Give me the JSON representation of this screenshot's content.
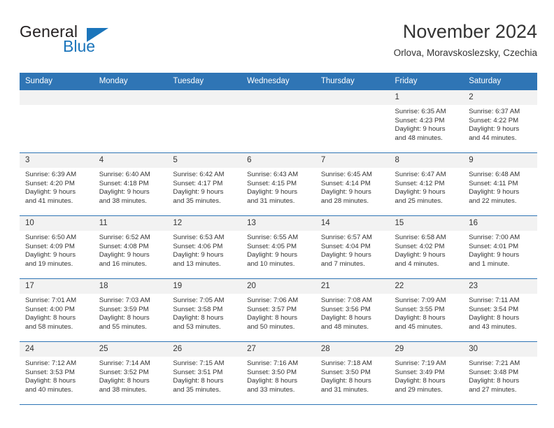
{
  "brand": {
    "name_part1": "General",
    "name_part2": "Blue",
    "accent_color": "#1b75bb"
  },
  "header": {
    "title": "November 2024",
    "subtitle": "Orlova, Moravskoslezsky, Czechia"
  },
  "theme": {
    "header_bg": "#2f75b5",
    "daynum_bg": "#f2f2f2",
    "text_color": "#333333"
  },
  "calendar": {
    "weekday_headers": [
      "Sunday",
      "Monday",
      "Tuesday",
      "Wednesday",
      "Thursday",
      "Friday",
      "Saturday"
    ],
    "weeks": [
      [
        {
          "day": "",
          "lines": []
        },
        {
          "day": "",
          "lines": []
        },
        {
          "day": "",
          "lines": []
        },
        {
          "day": "",
          "lines": []
        },
        {
          "day": "",
          "lines": []
        },
        {
          "day": "1",
          "lines": [
            "Sunrise: 6:35 AM",
            "Sunset: 4:23 PM",
            "Daylight: 9 hours",
            "and 48 minutes."
          ]
        },
        {
          "day": "2",
          "lines": [
            "Sunrise: 6:37 AM",
            "Sunset: 4:22 PM",
            "Daylight: 9 hours",
            "and 44 minutes."
          ]
        }
      ],
      [
        {
          "day": "3",
          "lines": [
            "Sunrise: 6:39 AM",
            "Sunset: 4:20 PM",
            "Daylight: 9 hours",
            "and 41 minutes."
          ]
        },
        {
          "day": "4",
          "lines": [
            "Sunrise: 6:40 AM",
            "Sunset: 4:18 PM",
            "Daylight: 9 hours",
            "and 38 minutes."
          ]
        },
        {
          "day": "5",
          "lines": [
            "Sunrise: 6:42 AM",
            "Sunset: 4:17 PM",
            "Daylight: 9 hours",
            "and 35 minutes."
          ]
        },
        {
          "day": "6",
          "lines": [
            "Sunrise: 6:43 AM",
            "Sunset: 4:15 PM",
            "Daylight: 9 hours",
            "and 31 minutes."
          ]
        },
        {
          "day": "7",
          "lines": [
            "Sunrise: 6:45 AM",
            "Sunset: 4:14 PM",
            "Daylight: 9 hours",
            "and 28 minutes."
          ]
        },
        {
          "day": "8",
          "lines": [
            "Sunrise: 6:47 AM",
            "Sunset: 4:12 PM",
            "Daylight: 9 hours",
            "and 25 minutes."
          ]
        },
        {
          "day": "9",
          "lines": [
            "Sunrise: 6:48 AM",
            "Sunset: 4:11 PM",
            "Daylight: 9 hours",
            "and 22 minutes."
          ]
        }
      ],
      [
        {
          "day": "10",
          "lines": [
            "Sunrise: 6:50 AM",
            "Sunset: 4:09 PM",
            "Daylight: 9 hours",
            "and 19 minutes."
          ]
        },
        {
          "day": "11",
          "lines": [
            "Sunrise: 6:52 AM",
            "Sunset: 4:08 PM",
            "Daylight: 9 hours",
            "and 16 minutes."
          ]
        },
        {
          "day": "12",
          "lines": [
            "Sunrise: 6:53 AM",
            "Sunset: 4:06 PM",
            "Daylight: 9 hours",
            "and 13 minutes."
          ]
        },
        {
          "day": "13",
          "lines": [
            "Sunrise: 6:55 AM",
            "Sunset: 4:05 PM",
            "Daylight: 9 hours",
            "and 10 minutes."
          ]
        },
        {
          "day": "14",
          "lines": [
            "Sunrise: 6:57 AM",
            "Sunset: 4:04 PM",
            "Daylight: 9 hours",
            "and 7 minutes."
          ]
        },
        {
          "day": "15",
          "lines": [
            "Sunrise: 6:58 AM",
            "Sunset: 4:02 PM",
            "Daylight: 9 hours",
            "and 4 minutes."
          ]
        },
        {
          "day": "16",
          "lines": [
            "Sunrise: 7:00 AM",
            "Sunset: 4:01 PM",
            "Daylight: 9 hours",
            "and 1 minute."
          ]
        }
      ],
      [
        {
          "day": "17",
          "lines": [
            "Sunrise: 7:01 AM",
            "Sunset: 4:00 PM",
            "Daylight: 8 hours",
            "and 58 minutes."
          ]
        },
        {
          "day": "18",
          "lines": [
            "Sunrise: 7:03 AM",
            "Sunset: 3:59 PM",
            "Daylight: 8 hours",
            "and 55 minutes."
          ]
        },
        {
          "day": "19",
          "lines": [
            "Sunrise: 7:05 AM",
            "Sunset: 3:58 PM",
            "Daylight: 8 hours",
            "and 53 minutes."
          ]
        },
        {
          "day": "20",
          "lines": [
            "Sunrise: 7:06 AM",
            "Sunset: 3:57 PM",
            "Daylight: 8 hours",
            "and 50 minutes."
          ]
        },
        {
          "day": "21",
          "lines": [
            "Sunrise: 7:08 AM",
            "Sunset: 3:56 PM",
            "Daylight: 8 hours",
            "and 48 minutes."
          ]
        },
        {
          "day": "22",
          "lines": [
            "Sunrise: 7:09 AM",
            "Sunset: 3:55 PM",
            "Daylight: 8 hours",
            "and 45 minutes."
          ]
        },
        {
          "day": "23",
          "lines": [
            "Sunrise: 7:11 AM",
            "Sunset: 3:54 PM",
            "Daylight: 8 hours",
            "and 43 minutes."
          ]
        }
      ],
      [
        {
          "day": "24",
          "lines": [
            "Sunrise: 7:12 AM",
            "Sunset: 3:53 PM",
            "Daylight: 8 hours",
            "and 40 minutes."
          ]
        },
        {
          "day": "25",
          "lines": [
            "Sunrise: 7:14 AM",
            "Sunset: 3:52 PM",
            "Daylight: 8 hours",
            "and 38 minutes."
          ]
        },
        {
          "day": "26",
          "lines": [
            "Sunrise: 7:15 AM",
            "Sunset: 3:51 PM",
            "Daylight: 8 hours",
            "and 35 minutes."
          ]
        },
        {
          "day": "27",
          "lines": [
            "Sunrise: 7:16 AM",
            "Sunset: 3:50 PM",
            "Daylight: 8 hours",
            "and 33 minutes."
          ]
        },
        {
          "day": "28",
          "lines": [
            "Sunrise: 7:18 AM",
            "Sunset: 3:50 PM",
            "Daylight: 8 hours",
            "and 31 minutes."
          ]
        },
        {
          "day": "29",
          "lines": [
            "Sunrise: 7:19 AM",
            "Sunset: 3:49 PM",
            "Daylight: 8 hours",
            "and 29 minutes."
          ]
        },
        {
          "day": "30",
          "lines": [
            "Sunrise: 7:21 AM",
            "Sunset: 3:48 PM",
            "Daylight: 8 hours",
            "and 27 minutes."
          ]
        }
      ]
    ]
  }
}
